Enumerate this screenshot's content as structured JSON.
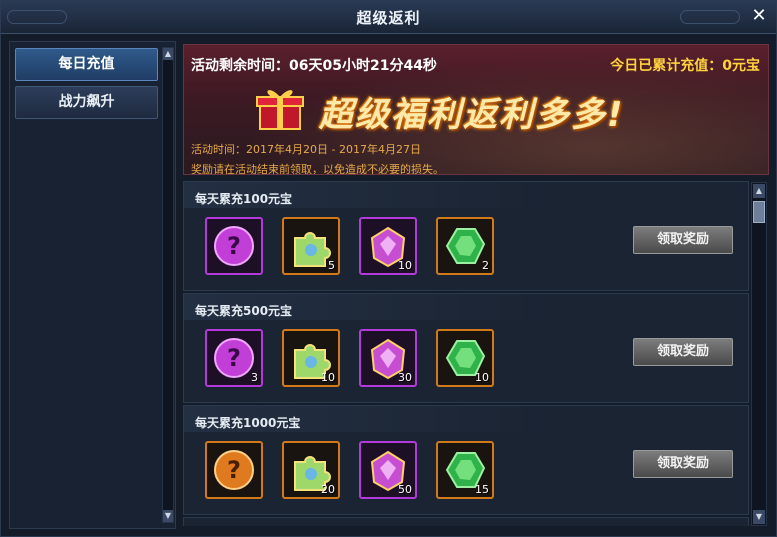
{
  "window": {
    "title": "超级返利",
    "close_label": "✕"
  },
  "sidebar": {
    "items": [
      {
        "label": "每日充值",
        "active": true
      },
      {
        "label": "战力飙升",
        "active": false
      }
    ]
  },
  "banner": {
    "countdown": "活动剩余时间：06天05小时21分44秒",
    "total": "今日已累计充值：0元宝",
    "title": "超级福利返利多多!",
    "event_time": "活动时间：2017年4月20日 - 2017年4月27日",
    "note": "奖励请在活动结束前领取，以免造成不必要的损失。"
  },
  "rewards": [
    {
      "title": "每天累充100元宝",
      "claim_label": "领取奖励",
      "items": [
        {
          "icon": "purple-mystery-orb-icon",
          "count": ""
        },
        {
          "icon": "rainbow-puzzle-icon",
          "count": "5"
        },
        {
          "icon": "purple-gem-icon",
          "count": "10"
        },
        {
          "icon": "green-gem-icon",
          "count": "2"
        }
      ]
    },
    {
      "title": "每天累充500元宝",
      "claim_label": "领取奖励",
      "items": [
        {
          "icon": "purple-mystery-orb-icon",
          "count": "3"
        },
        {
          "icon": "rainbow-puzzle-icon",
          "count": "10"
        },
        {
          "icon": "purple-gem-icon",
          "count": "30"
        },
        {
          "icon": "green-gem-icon",
          "count": "10"
        }
      ]
    },
    {
      "title": "每天累充1000元宝",
      "claim_label": "领取奖励",
      "items": [
        {
          "icon": "orange-mystery-orb-icon",
          "count": ""
        },
        {
          "icon": "rainbow-puzzle-icon",
          "count": "20"
        },
        {
          "icon": "purple-gem-icon",
          "count": "50"
        },
        {
          "icon": "green-gem-icon",
          "count": "15"
        }
      ]
    }
  ],
  "colors": {
    "accent_gold": "#ffd23e",
    "note_orange": "#e7a94a",
    "purple_frame": "#b13ad9",
    "orange_frame": "#d07a19"
  }
}
